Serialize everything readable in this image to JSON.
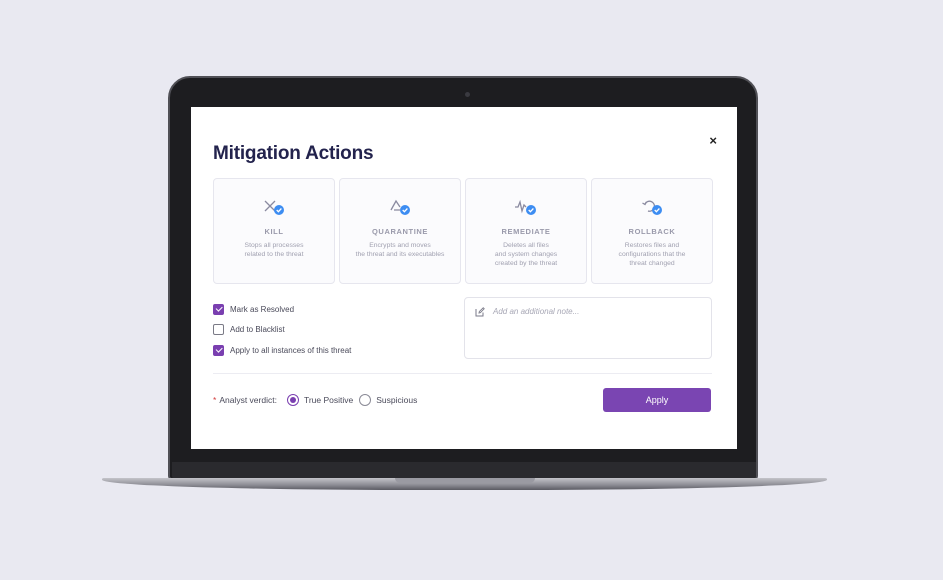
{
  "dialog": {
    "title": "Mitigation Actions",
    "close_glyph": "×"
  },
  "actions": [
    {
      "label": "KILL",
      "desc1": "Stops all processes",
      "desc2": "related to the threat",
      "desc3": "",
      "icon": "kill-icon"
    },
    {
      "label": "QUARANTINE",
      "desc1": "Encrypts and moves",
      "desc2": "the threat and its executables",
      "desc3": "",
      "icon": "quarantine-icon"
    },
    {
      "label": "REMEDIATE",
      "desc1": "Deletes all files",
      "desc2": "and system changes",
      "desc3": "created by the threat",
      "icon": "remediate-icon"
    },
    {
      "label": "ROLLBACK",
      "desc1": "Restores files and",
      "desc2": "configurations that the",
      "desc3": "threat changed",
      "icon": "rollback-icon"
    }
  ],
  "options": [
    {
      "label": "Mark as Resolved",
      "checked": true
    },
    {
      "label": "Add to Blacklist",
      "checked": false
    },
    {
      "label": "Apply to all instances of this threat",
      "checked": true
    }
  ],
  "note": {
    "placeholder": "Add an additional note..."
  },
  "verdict": {
    "required_mark": "*",
    "label": "Analyst verdict:",
    "options": [
      {
        "label": "True Positive",
        "selected": true
      },
      {
        "label": "Suspicious",
        "selected": false
      }
    ]
  },
  "apply_label": "Apply",
  "colors": {
    "accent": "#7a45b2",
    "check_badge": "#3d8df2",
    "title": "#23234d"
  }
}
